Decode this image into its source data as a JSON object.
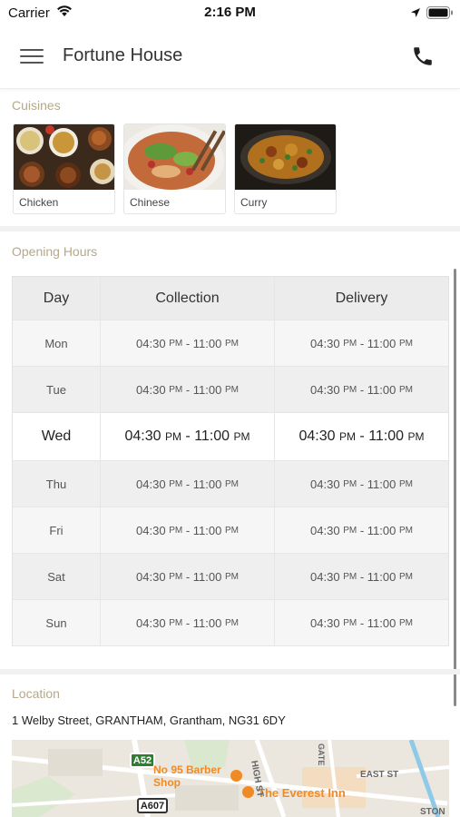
{
  "status_bar": {
    "carrier": "Carrier",
    "time": "2:16 PM"
  },
  "header": {
    "title": "Fortune House"
  },
  "cuisines": {
    "title": "Cuisines",
    "items": [
      {
        "label": "Chicken"
      },
      {
        "label": "Chinese"
      },
      {
        "label": "Curry"
      }
    ]
  },
  "opening_hours": {
    "title": "Opening Hours",
    "columns": [
      "Day",
      "Collection",
      "Delivery"
    ],
    "rows": [
      {
        "day": "Mon",
        "collection": {
          "open": "04:30",
          "open_ampm": "PM",
          "close": "11:00",
          "close_ampm": "PM"
        },
        "delivery": {
          "open": "04:30",
          "open_ampm": "PM",
          "close": "11:00",
          "close_ampm": "PM"
        }
      },
      {
        "day": "Tue",
        "collection": {
          "open": "04:30",
          "open_ampm": "PM",
          "close": "11:00",
          "close_ampm": "PM"
        },
        "delivery": {
          "open": "04:30",
          "open_ampm": "PM",
          "close": "11:00",
          "close_ampm": "PM"
        }
      },
      {
        "day": "Wed",
        "collection": {
          "open": "04:30",
          "open_ampm": "PM",
          "close": "11:00",
          "close_ampm": "PM"
        },
        "delivery": {
          "open": "04:30",
          "open_ampm": "PM",
          "close": "11:00",
          "close_ampm": "PM"
        }
      },
      {
        "day": "Thu",
        "collection": {
          "open": "04:30",
          "open_ampm": "PM",
          "close": "11:00",
          "close_ampm": "PM"
        },
        "delivery": {
          "open": "04:30",
          "open_ampm": "PM",
          "close": "11:00",
          "close_ampm": "PM"
        }
      },
      {
        "day": "Fri",
        "collection": {
          "open": "04:30",
          "open_ampm": "PM",
          "close": "11:00",
          "close_ampm": "PM"
        },
        "delivery": {
          "open": "04:30",
          "open_ampm": "PM",
          "close": "11:00",
          "close_ampm": "PM"
        }
      },
      {
        "day": "Sat",
        "collection": {
          "open": "04:30",
          "open_ampm": "PM",
          "close": "11:00",
          "close_ampm": "PM"
        },
        "delivery": {
          "open": "04:30",
          "open_ampm": "PM",
          "close": "11:00",
          "close_ampm": "PM"
        }
      },
      {
        "day": "Sun",
        "collection": {
          "open": "04:30",
          "open_ampm": "PM",
          "close": "11:00",
          "close_ampm": "PM"
        },
        "delivery": {
          "open": "04:30",
          "open_ampm": "PM",
          "close": "11:00",
          "close_ampm": "PM"
        }
      }
    ],
    "highlighted_day": "Wed"
  },
  "location": {
    "title": "Location",
    "address": "1 Welby Street, GRANTHAM, Grantham, NG31 6DY",
    "map_labels": {
      "road_a52": "A52",
      "road_a607": "A607",
      "poi_barber": "No 95 Barber Shop",
      "poi_restaurant": "The Everest Inn",
      "street_high": "HIGH ST",
      "street_east": "EAST ST",
      "street_station": "STON",
      "street_gate": "GATE"
    }
  },
  "colors": {
    "section_title": "#b5a98a",
    "header_bg": "#ececec",
    "today_row_bg": "#ffffff",
    "poi_orange": "#f08a24",
    "road_green": "#2e7d32"
  },
  "icons": [
    "wifi-icon",
    "location-arrow-icon",
    "battery-icon",
    "hamburger-menu-icon",
    "phone-icon"
  ]
}
